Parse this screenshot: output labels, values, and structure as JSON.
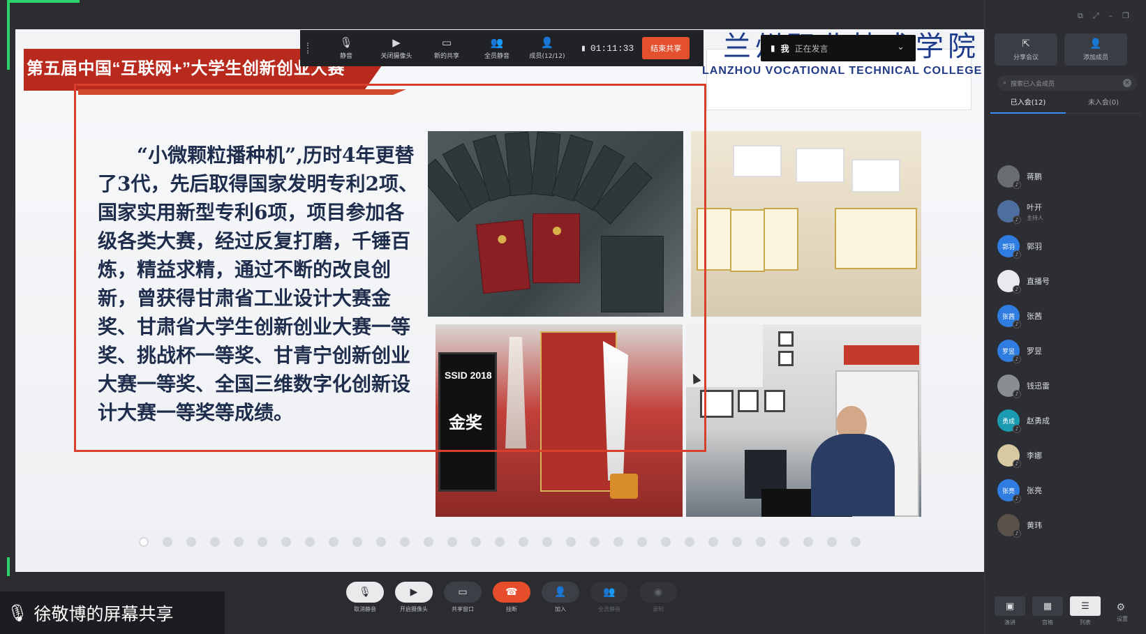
{
  "slide": {
    "title": "第五届中国“互联网+”大学生创新创业大赛",
    "college_cn": "兰州职业技术学院",
    "college_en": "LANZHOU VOCATIONAL TECHNICAL COLLEGE",
    "body": "“小微颗粒播种机”,历时4年更替了3代，先后取得国家发明专利2项、国家实用新型专利6项，项目参加各级各类大赛，经过反复打磨，千锤百炼，精益求精，通过不断的改良创新，曾获得甘肃省工业设计大赛金奖、甘肃省大学生创新创业大赛一等奖、挑战杯一等奖、甘青宁创新创业大赛一等奖、全国三维数字化创新设计大赛一等奖等成绩。",
    "award_label": "SSID 2018",
    "award_sub": "金奖",
    "page_count": 31,
    "current_page": 1
  },
  "speaker": {
    "name": "我",
    "status": "正在发言"
  },
  "share_toolbar": {
    "items": [
      {
        "icon": "mic-icon",
        "glyph": "🎙",
        "label": "静音"
      },
      {
        "icon": "camera-icon",
        "glyph": "▶",
        "label": "关闭摄像头"
      },
      {
        "icon": "screen-share-icon",
        "glyph": "▭",
        "label": "新的共享"
      },
      {
        "icon": "mute-all-icon",
        "glyph": "👥",
        "label": "全员静音"
      },
      {
        "icon": "members-icon",
        "glyph": "👤",
        "label": "成员(12/12)"
      }
    ],
    "timer": "01:11:33",
    "end_share": "结束共享"
  },
  "panel": {
    "invite_label": "分享会议",
    "add_member_label": "添加成员",
    "search_placeholder": "搜索已入会成员",
    "tab_joined": "已入会(12)",
    "tab_not_joined": "未入会(0)",
    "members": [
      {
        "name": "蒋鹏",
        "sub": "",
        "avatar_text": "",
        "color": "#6a6d72"
      },
      {
        "name": "叶开",
        "sub": "主持人",
        "avatar_text": "",
        "color": "#4d6fa0"
      },
      {
        "name": "郭羽",
        "sub": "",
        "avatar_text": "郭羽",
        "color": "#2f7de1"
      },
      {
        "name": "直播号",
        "sub": "",
        "avatar_text": "",
        "color": "#e8eaed"
      },
      {
        "name": "张茜",
        "sub": "",
        "avatar_text": "张茜",
        "color": "#2f7de1"
      },
      {
        "name": "罗昱",
        "sub": "",
        "avatar_text": "罗昱",
        "color": "#2f7de1"
      },
      {
        "name": "钱迅雷",
        "sub": "",
        "avatar_text": "",
        "color": "#8a8d92"
      },
      {
        "name": "赵勇成",
        "sub": "",
        "avatar_text": "勇成",
        "color": "#1b9bb1"
      },
      {
        "name": "李娜",
        "sub": "",
        "avatar_text": "",
        "color": "#d9c9a3"
      },
      {
        "name": "张亮",
        "sub": "",
        "avatar_text": "张亮",
        "color": "#2f7de1"
      },
      {
        "name": "黄玮",
        "sub": "",
        "avatar_text": "",
        "color": "#5a5148"
      }
    ],
    "views": [
      {
        "label": "演讲",
        "glyph": "▣"
      },
      {
        "label": "宫格",
        "glyph": "▦"
      },
      {
        "label": "列表",
        "glyph": "☰"
      }
    ],
    "settings_label": "设置"
  },
  "bottom": {
    "share_owner": "徐敬博的屏幕共享",
    "controls": [
      {
        "label": "取消静音",
        "glyph": "🎙",
        "style": "light"
      },
      {
        "label": "开启摄像头",
        "glyph": "▶",
        "style": "light"
      },
      {
        "label": "共享窗口",
        "glyph": "▭",
        "style": "normal"
      },
      {
        "label": "挂断",
        "glyph": "☎",
        "style": "danger"
      },
      {
        "label": "加入",
        "glyph": "👤",
        "style": "normal"
      },
      {
        "label": "全员静音",
        "glyph": "👥",
        "style": "disabled"
      },
      {
        "label": "录制",
        "glyph": "◉",
        "style": "disabled"
      }
    ]
  }
}
